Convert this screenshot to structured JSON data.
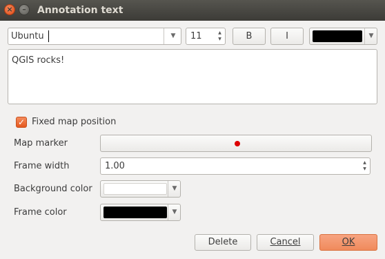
{
  "window": {
    "title": "Annotation text"
  },
  "toolbar": {
    "font_name": "Ubuntu",
    "font_size": "11",
    "bold_label": "B",
    "italic_label": "I",
    "text_color": "#000000"
  },
  "editor": {
    "content": "QGIS rocks!"
  },
  "fixed_position": {
    "label": "Fixed map position",
    "checked": true
  },
  "properties": {
    "map_marker_label": "Map marker",
    "marker_color": "#dd0000",
    "frame_width_label": "Frame width",
    "frame_width_value": "1.00",
    "background_color_label": "Background color",
    "background_color": "#ffffff",
    "frame_color_label": "Frame color",
    "frame_color": "#000000"
  },
  "buttons": {
    "delete": "Delete",
    "cancel": "Cancel",
    "ok": "OK"
  },
  "colors": {
    "accent": "#f08a5c",
    "titlebar": "#3c3b37"
  }
}
